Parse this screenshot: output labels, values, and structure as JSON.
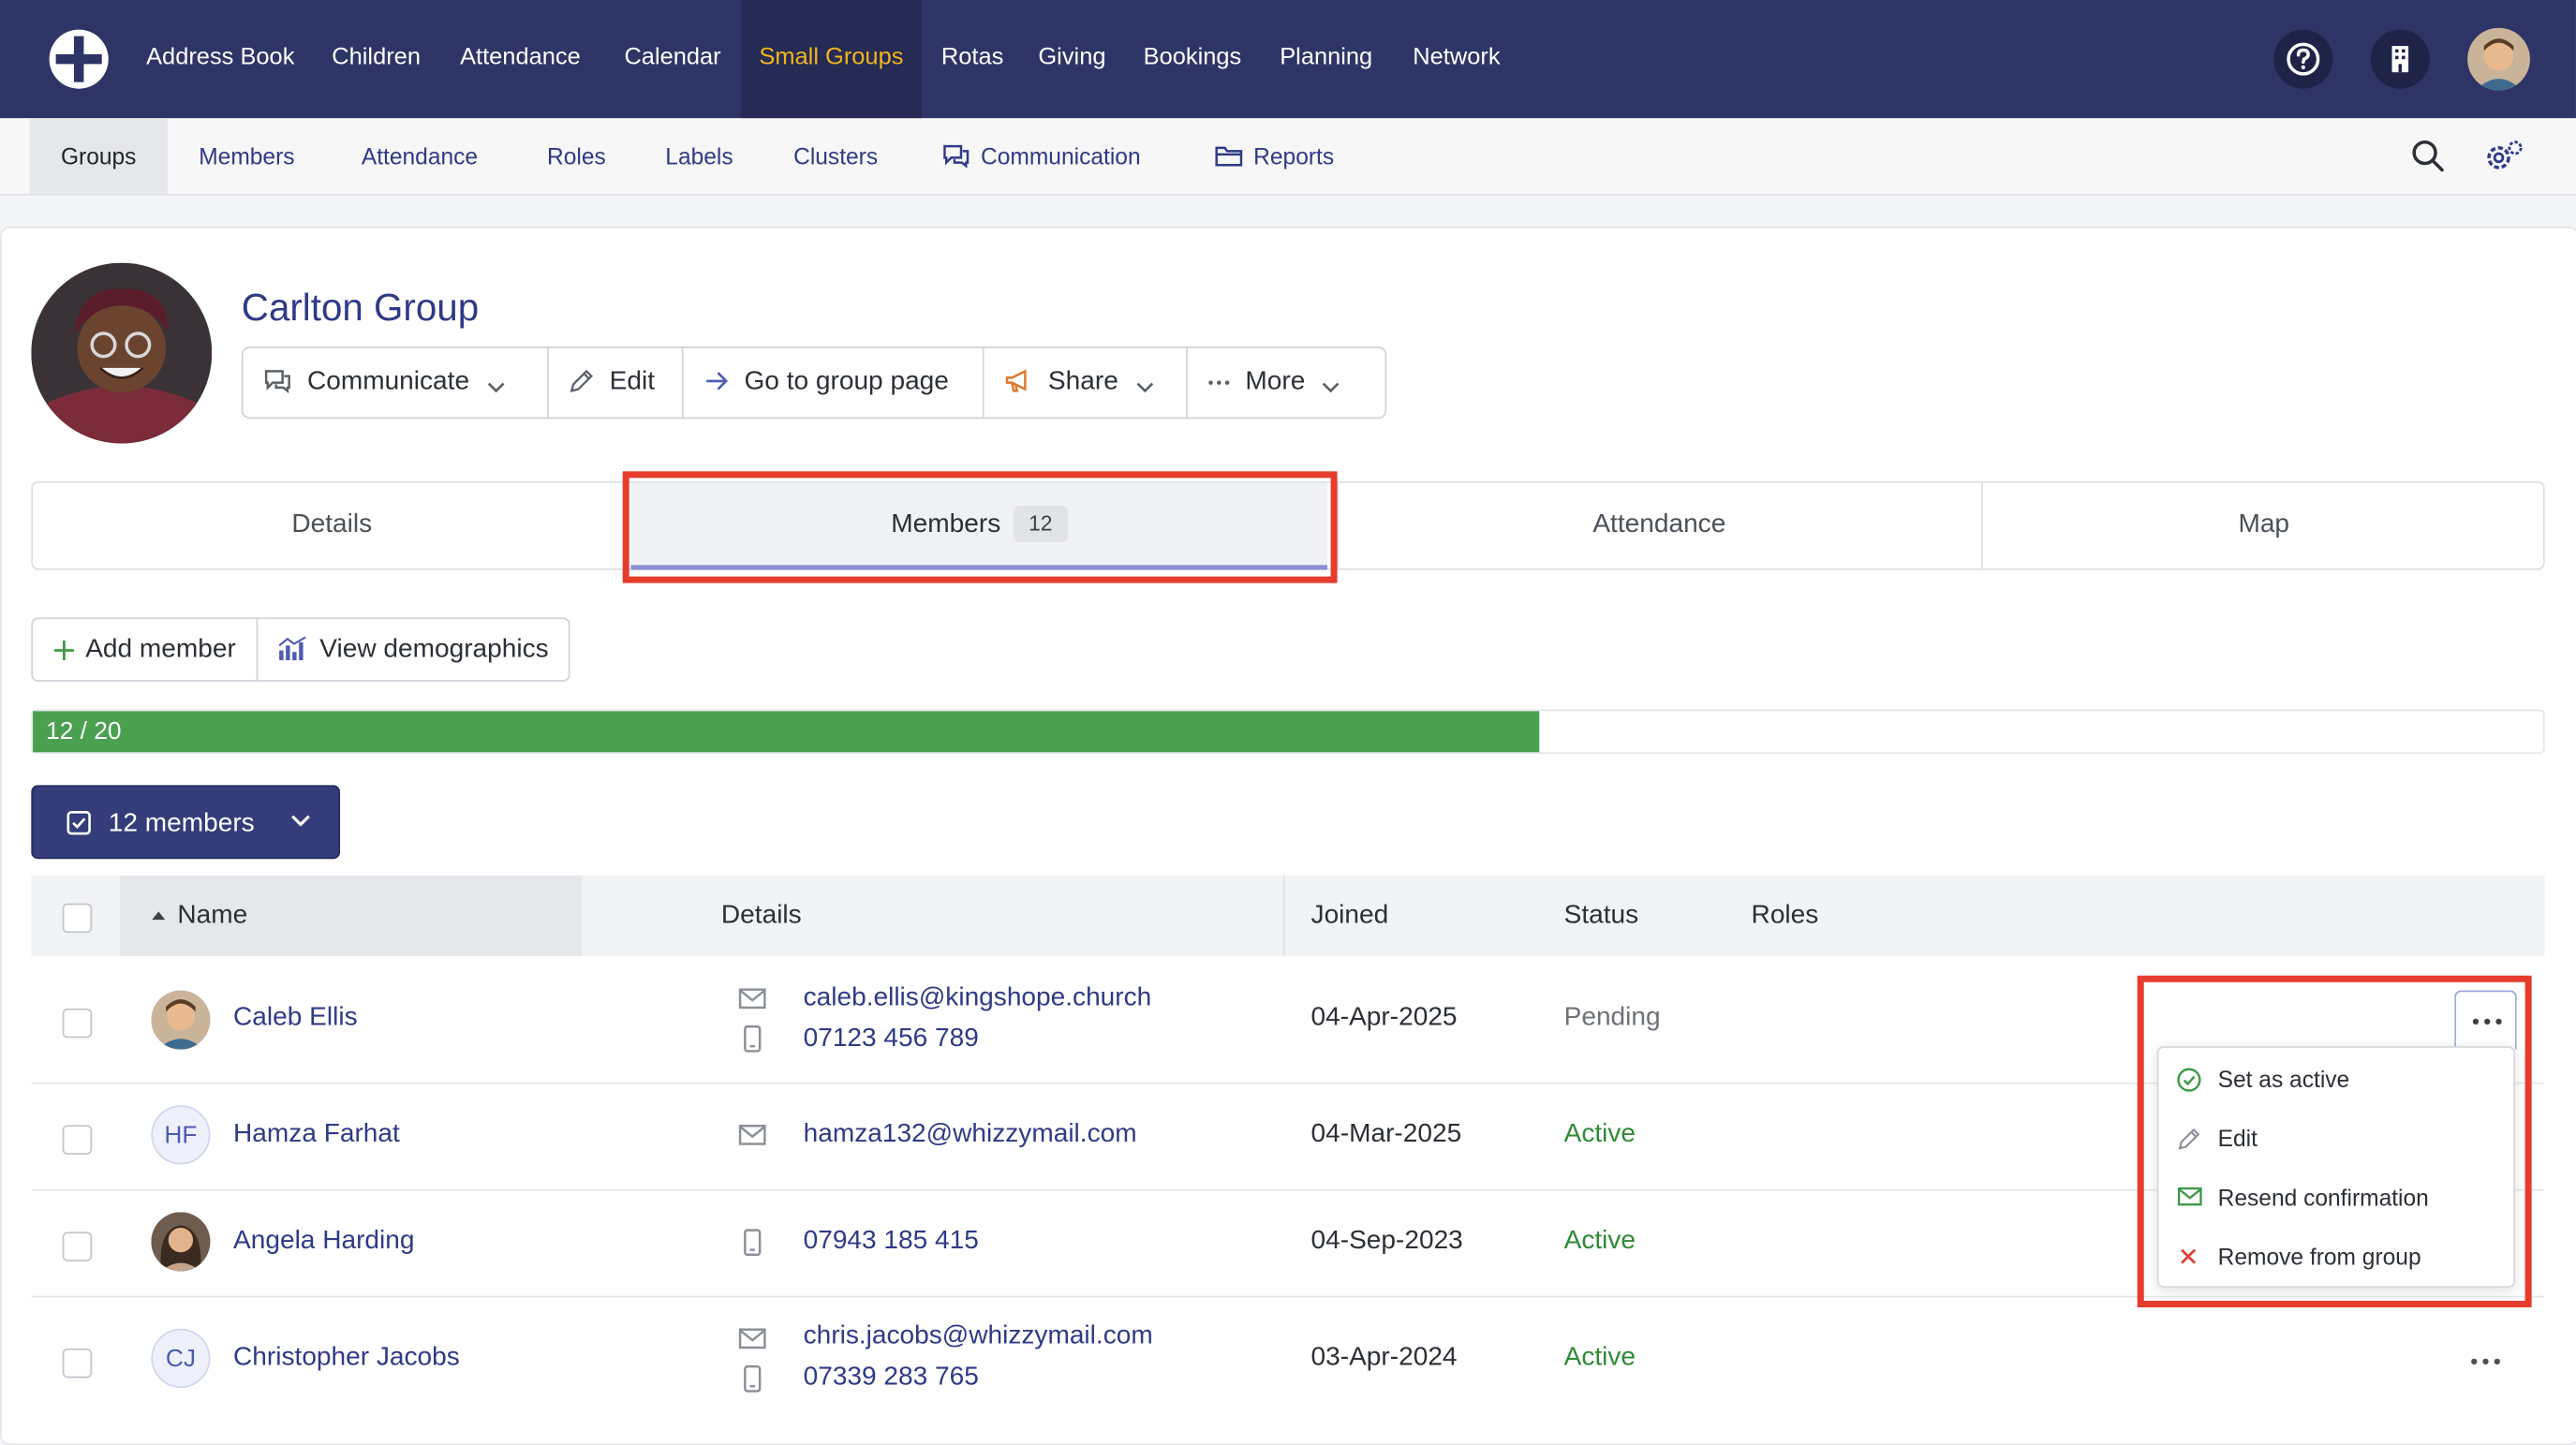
{
  "topnav": {
    "items": [
      "Address Book",
      "Children",
      "Attendance",
      "Calendar",
      "Small Groups",
      "Rotas",
      "Giving",
      "Bookings",
      "Planning",
      "Network"
    ],
    "active": "Small Groups"
  },
  "subnav": {
    "items": [
      "Groups",
      "Members",
      "Attendance",
      "Roles",
      "Labels",
      "Clusters",
      "Communication",
      "Reports"
    ],
    "active": "Groups"
  },
  "group": {
    "title": "Carlton Group",
    "buttons": {
      "communicate": "Communicate",
      "edit": "Edit",
      "go_to_page": "Go to group page",
      "share": "Share",
      "more": "More"
    }
  },
  "tabs": {
    "details": "Details",
    "members": "Members",
    "members_count": "12",
    "attendance": "Attendance",
    "map": "Map"
  },
  "actions": {
    "add_member": "Add member",
    "view_demographics": "View demographics"
  },
  "capacity": {
    "label": "12 / 20",
    "fraction": 0.6
  },
  "selection": {
    "label": "12 members"
  },
  "table": {
    "headers": {
      "name": "Name",
      "details": "Details",
      "joined": "Joined",
      "status": "Status",
      "roles": "Roles"
    },
    "rows": [
      {
        "name": "Caleb Ellis",
        "email": "caleb.ellis@kingshope.church",
        "phone": "07123 456 789",
        "joined": "04-Apr-2025",
        "status": "Pending"
      },
      {
        "name": "Hamza Farhat",
        "initials": "HF",
        "email": "hamza132@whizzymail.com",
        "joined": "04-Mar-2025",
        "status": "Active"
      },
      {
        "name": "Angela Harding",
        "phone": "07943 185 415",
        "joined": "04-Sep-2023",
        "status": "Active"
      },
      {
        "name": "Christopher Jacobs",
        "initials": "CJ",
        "email": "chris.jacobs@whizzymail.com",
        "phone": "07339 283 765",
        "joined": "03-Apr-2024",
        "status": "Active"
      }
    ]
  },
  "row_menu": {
    "items": [
      "Set as active",
      "Edit",
      "Resend confirmation",
      "Remove from group"
    ]
  },
  "colors": {
    "nav_bg": "#2e3566",
    "nav_active": "#f3b51c",
    "link": "#2f3a86",
    "progress": "#4aa04f",
    "status_active": "#2e8b35",
    "highlight": "#e53c2c"
  },
  "icons": [
    "church-logo-icon",
    "help-icon",
    "building-icon",
    "search-icon",
    "settings-gear-icon",
    "chat-icon",
    "folder-icon",
    "pencil-icon",
    "arrow-right-icon",
    "megaphone-icon",
    "ellipsis-icon",
    "chevron-down-icon",
    "plus-icon",
    "bar-chart-icon",
    "checkbox-icon",
    "sort-up-icon",
    "mail-icon",
    "phone-icon",
    "check-circle-icon",
    "close-icon"
  ]
}
